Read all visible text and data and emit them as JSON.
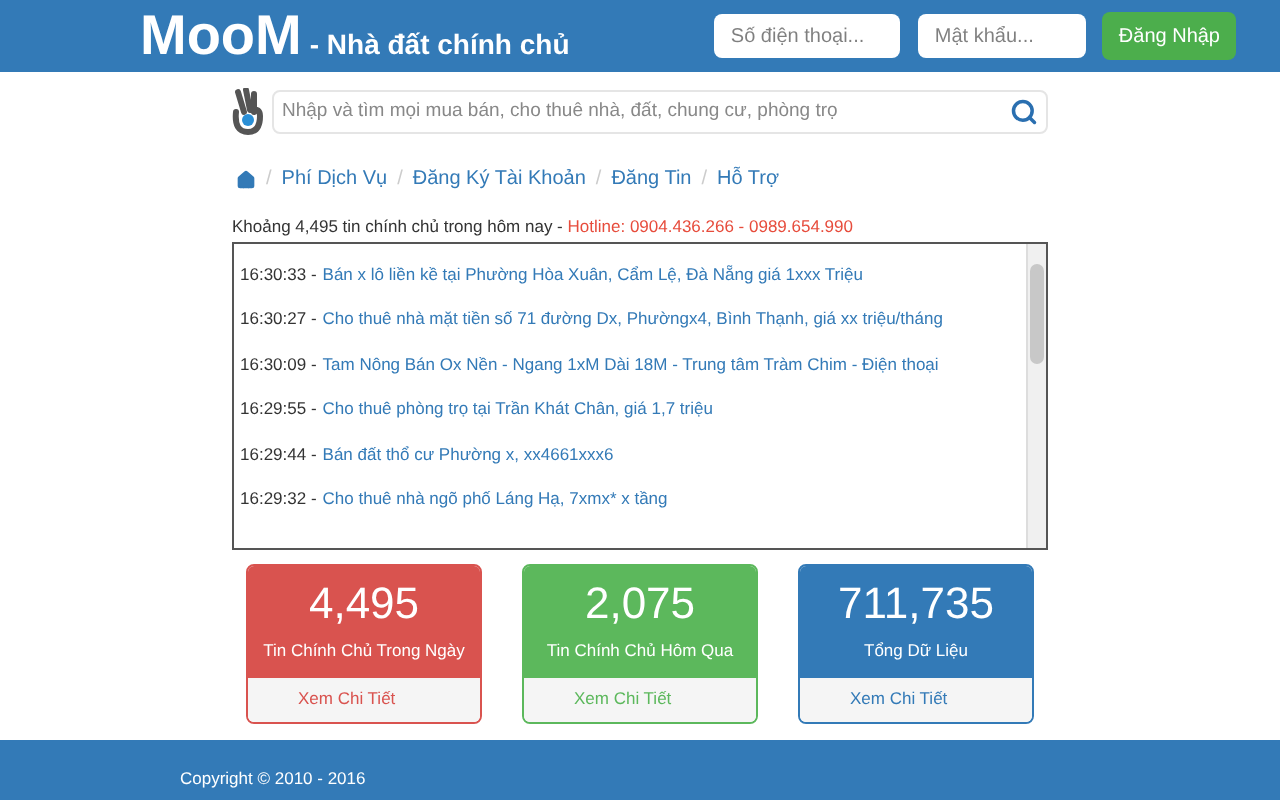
{
  "header": {
    "logo": "MooM",
    "tagline": "- Nhà đất chính chủ",
    "phone_placeholder": "Số điện thoại...",
    "password_placeholder": "Mật khẩu...",
    "login_button": "Đăng Nhập"
  },
  "search": {
    "placeholder": "Nhập và tìm mọi mua bán, cho thuê nhà, đất, chung cư, phòng trọ"
  },
  "breadcrumb_separator": "/",
  "breadcrumb": [
    "Phí Dịch Vụ",
    "Đăng Ký Tài Khoản",
    "Đăng Tin",
    "Hỗ Trợ"
  ],
  "summary": {
    "text": "Khoảng 4,495 tin chính chủ trong hôm nay -",
    "hotline": "Hotline: 0904.436.266 - 0989.654.990"
  },
  "listings": [
    {
      "time": "16:30:33 -",
      "title": "Bán x lô liền kề tại Phường Hòa Xuân, Cẩm Lệ, Đà Nẵng giá 1xxx Triệu"
    },
    {
      "time": "16:30:27 -",
      "title": "Cho thuê nhà mặt tiền số 71 đường Dx, Phườngx4, Bình Thạnh, giá xx triệu/tháng"
    },
    {
      "time": "16:30:09 -",
      "title": "Tam Nông Bán Ox Nền - Ngang 1xM Dài 18M - Trung tâm Tràm Chim - Điện thoại"
    },
    {
      "time": "16:29:55 -",
      "title": "Cho thuê phòng trọ tại Trần Khát Chân, giá 1,7 triệu"
    },
    {
      "time": "16:29:44 -",
      "title": "Bán đất thổ cư Phường x, xx4661xxx6"
    },
    {
      "time": "16:29:32 -",
      "title": "Cho thuê nhà ngõ phố Láng Hạ, 7xmx* x tầng"
    }
  ],
  "stats": [
    {
      "value": "4,495",
      "label": "Tin Chính Chủ Trong Ngày",
      "link": "Xem Chi Tiết",
      "color": "#d9534f"
    },
    {
      "value": "2,075",
      "label": "Tin Chính Chủ Hôm Qua",
      "link": "Xem Chi Tiết",
      "color": "#5cb85c"
    },
    {
      "value": "711,735",
      "label": "Tổng Dữ Liệu",
      "link": "Xem Chi Tiết",
      "color": "#337ab7"
    }
  ],
  "footer": {
    "copyright": "Copyright © 2010 - 2016"
  }
}
